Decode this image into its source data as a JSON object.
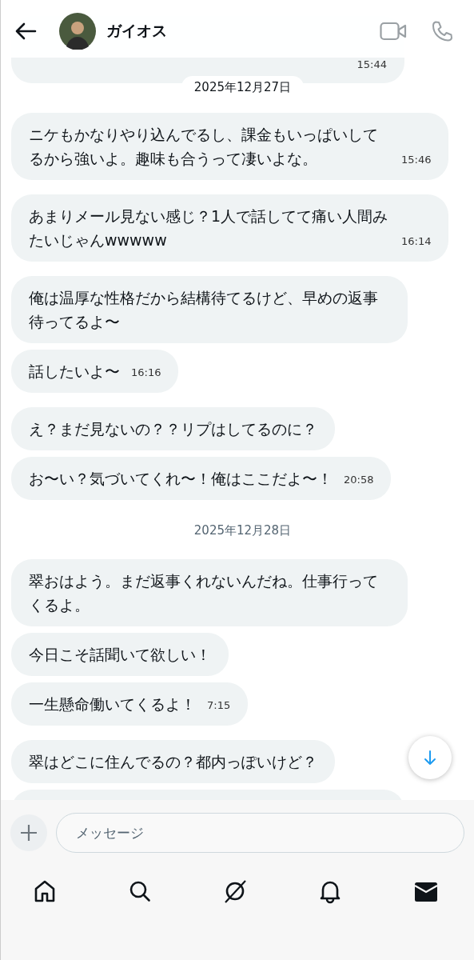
{
  "header": {
    "back": true,
    "contact_name": "ガイオス"
  },
  "thread": [
    {
      "kind": "group",
      "messages": [
        {
          "kind": "cut",
          "time": "15:44"
        }
      ]
    },
    {
      "kind": "date",
      "label": "2025年12月27日",
      "sticky": true
    },
    {
      "kind": "group",
      "messages": [
        {
          "text": "ニケもかなりやり込んでるし、課金もいっぱいしてるから強いよ。趣味も合うって凄いよな。",
          "time": "15:46"
        }
      ]
    },
    {
      "kind": "group",
      "messages": [
        {
          "text": "あまりメール見ない感じ？1人で話してて痛い人間みたいじゃんwwwww",
          "time": "16:14"
        }
      ]
    },
    {
      "kind": "group",
      "messages": [
        {
          "text": "俺は温厚な性格だから結構待てるけど、早めの返事待ってるよ〜"
        },
        {
          "text": "話したいよ〜",
          "time": "16:16"
        }
      ]
    },
    {
      "kind": "group",
      "messages": [
        {
          "text": "え？まだ見ないの？？リプはしてるのに？"
        },
        {
          "text": "お〜い？気づいてくれ〜！俺はここだよ〜！",
          "time": "20:58"
        }
      ]
    },
    {
      "kind": "date",
      "label": "2025年12月28日",
      "sticky": false
    },
    {
      "kind": "group",
      "messages": [
        {
          "text": "翠おはよう。まだ返事くれないんだね。仕事行ってくるよ。"
        },
        {
          "text": "今日こそ話聞いて欲しい！"
        },
        {
          "text": "一生懸命働いてくるよ！",
          "time": "7:15"
        }
      ]
    },
    {
      "kind": "group",
      "messages": [
        {
          "text": "翠はどこに住んでるの？都内っぽいけど？"
        },
        {
          "kind": "cut"
        }
      ]
    }
  ],
  "composer": {
    "placeholder": "メッセージ"
  },
  "nav": [
    {
      "kind": "home",
      "selected": false
    },
    {
      "kind": "search",
      "selected": false
    },
    {
      "kind": "grok",
      "selected": false
    },
    {
      "kind": "bell",
      "selected": false
    },
    {
      "kind": "mail",
      "selected": true
    }
  ]
}
